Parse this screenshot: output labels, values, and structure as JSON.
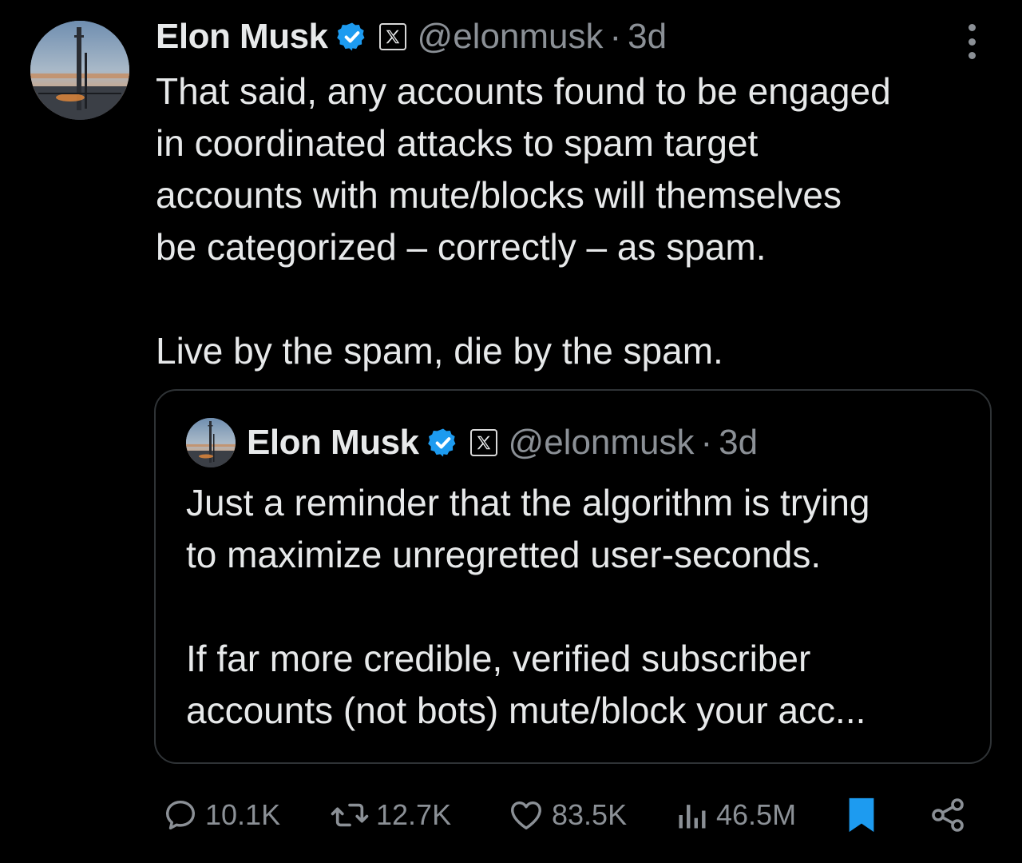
{
  "tweet": {
    "author_name": "Elon Musk",
    "handle": "@elonmusk",
    "separator": "·",
    "time": "3d",
    "text": "That said, any accounts found to be engaged\nin coordinated attacks to spam target\naccounts with mute/blocks will themselves\nbe categorized – correctly – as spam.\n\nLive by the spam, die by the spam."
  },
  "quoted_tweet": {
    "author_name": "Elon Musk",
    "handle": "@elonmusk",
    "separator": "·",
    "time": "3d",
    "text": "Just a reminder that the algorithm is trying\nto maximize unregretted user-seconds.\n\nIf far more credible, verified subscriber\naccounts (not bots) mute/block your acc..."
  },
  "actions": {
    "replies": "10.1K",
    "reposts": "12.7K",
    "likes": "83.5K",
    "views": "46.5M"
  },
  "icons": {
    "verified": "verified-badge-icon",
    "affiliate": "x-logo-icon",
    "more": "more-options-icon",
    "reply": "reply-icon",
    "repost": "repost-icon",
    "like": "heart-icon",
    "views": "views-icon",
    "bookmark": "bookmark-icon",
    "share": "share-icon"
  },
  "colors": {
    "background": "#000000",
    "text": "#e7e9ea",
    "secondary": "#8b9096",
    "verified": "#1d9bf0",
    "bookmark_active": "#1d9bf0",
    "border": "#2f3336"
  }
}
